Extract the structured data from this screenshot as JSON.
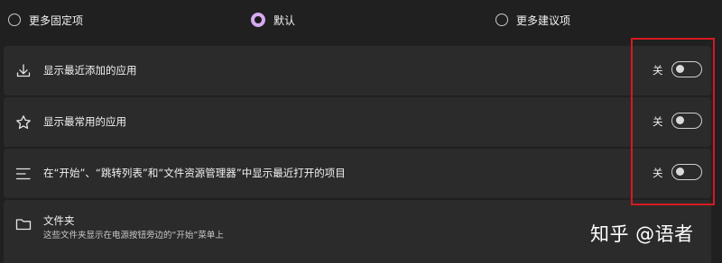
{
  "layout_options": [
    {
      "label": "更多固定项",
      "selected": false
    },
    {
      "label": "默认",
      "selected": true
    },
    {
      "label": "更多建议项",
      "selected": false
    }
  ],
  "settings": [
    {
      "icon": "download-icon",
      "label": "显示最近添加的应用",
      "toggle_state": "关",
      "on": false
    },
    {
      "icon": "star-icon",
      "label": "显示最常用的应用",
      "toggle_state": "关",
      "on": false
    },
    {
      "icon": "list-icon",
      "label": "在“开始”、“跳转列表”和“文件资源管理器”中显示最近打开的项目",
      "toggle_state": "关",
      "on": false
    }
  ],
  "folders": {
    "icon": "folder-icon",
    "label": "文件夹",
    "description": "这些文件夹显示在电源按钮旁边的“开始”菜单上"
  },
  "watermark": "知乎 @语者",
  "colors": {
    "background": "#202020",
    "card": "#2b2b2b",
    "accent": "#d6a9f2",
    "highlight": "#d71920"
  }
}
